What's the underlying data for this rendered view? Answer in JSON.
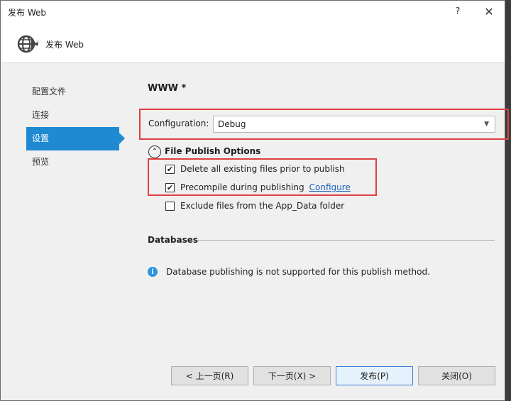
{
  "window": {
    "title": "发布 Web",
    "help_glyph": "?",
    "close_glyph": "✕"
  },
  "header": {
    "title": "发布 Web",
    "icon": "globe-publish-icon"
  },
  "nav": {
    "items": [
      {
        "label": "配置文件",
        "active": false
      },
      {
        "label": "连接",
        "active": false
      },
      {
        "label": "设置",
        "active": true
      },
      {
        "label": "预览",
        "active": false
      }
    ]
  },
  "main": {
    "profile_name": "WWW *",
    "configuration": {
      "label": "Configuration:",
      "value": "Debug"
    },
    "file_publish": {
      "title": "File Publish Options",
      "toggle_glyph": "⌃",
      "options": [
        {
          "label": "Delete all existing files prior to publish",
          "checked": true
        },
        {
          "label": "Precompile during publishing",
          "checked": true,
          "link": "Configure"
        },
        {
          "label": "Exclude files from the App_Data folder",
          "checked": false
        }
      ]
    },
    "databases": {
      "title": "Databases",
      "info": "Database publishing is not supported for this publish method."
    }
  },
  "buttons": {
    "prev": "< 上一页(R)",
    "next": "下一页(X) >",
    "publish": "发布(P)",
    "close": "关闭(O)"
  },
  "colors": {
    "accent": "#1f8ad2",
    "highlight": "#e04040",
    "link": "#1b63b8"
  }
}
